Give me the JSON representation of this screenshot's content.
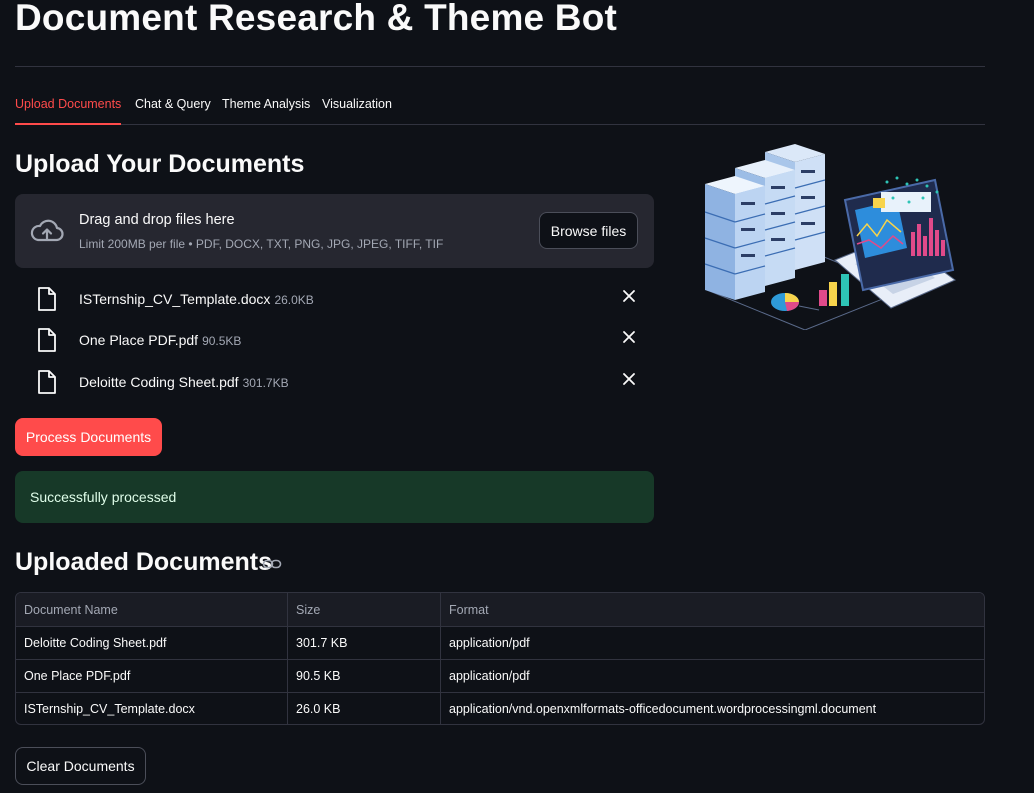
{
  "header": {
    "title": "Document Research & Theme Bot"
  },
  "tabs": [
    {
      "label": "Upload Documents",
      "active": true
    },
    {
      "label": "Chat & Query",
      "active": false
    },
    {
      "label": "Theme Analysis",
      "active": false
    },
    {
      "label": "Visualization",
      "active": false
    }
  ],
  "upload": {
    "heading": "Upload Your Documents",
    "dropzone_text": "Drag and drop files here",
    "dropzone_limit": "Limit 200MB per file • PDF, DOCX, TXT, PNG, JPG, JPEG, TIFF, TIF",
    "browse_label": "Browse files",
    "files": [
      {
        "name": "ISTernship_CV_Template.docx",
        "size": "26.0KB"
      },
      {
        "name": "One Place PDF.pdf",
        "size": "90.5KB"
      },
      {
        "name": "Deloitte Coding Sheet.pdf",
        "size": "301.7KB"
      }
    ],
    "process_label": "Process Documents",
    "success_message": "Successfully processed"
  },
  "uploaded": {
    "heading": "Uploaded Documents",
    "columns": [
      "Document Name",
      "Size",
      "Format"
    ],
    "rows": [
      [
        "Deloitte Coding Sheet.pdf",
        "301.7 KB",
        "application/pdf"
      ],
      [
        "One Place PDF.pdf",
        "90.5 KB",
        "application/pdf"
      ],
      [
        "ISTernship_CV_Template.docx",
        "26.0 KB",
        "application/vnd.openxmlformats-officedocument.wordprocessingml.document"
      ]
    ],
    "clear_label": "Clear Documents"
  },
  "colors": {
    "background": "#0e1117",
    "accent": "#ff4b4b",
    "panel": "#262730",
    "success_bg": "#173928"
  },
  "icons": [
    "cloud-upload-icon",
    "file-icon",
    "close-icon",
    "link-icon"
  ]
}
